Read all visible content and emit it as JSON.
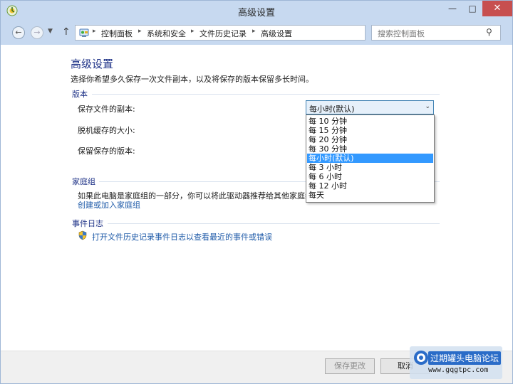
{
  "window": {
    "title": "高级设置",
    "minimize_glyph": "—",
    "maximize_glyph": "□",
    "close_glyph": "✕"
  },
  "nav": {
    "back_glyph": "←",
    "forward_glyph": "→",
    "recent_glyph": "▼",
    "up_glyph": "↑",
    "breadcrumbs": [
      "控制面板",
      "系统和安全",
      "文件历史记录",
      "高级设置"
    ],
    "separator_glyph": "▸",
    "address_dropdown_glyph": "▼",
    "refresh_glyph": "↻",
    "search_placeholder": "搜索控制面板",
    "search_glyph": "⚲"
  },
  "content": {
    "title": "高级设置",
    "description": "选择你希望多久保存一次文件副本，以及将保存的版本保留多长时间。",
    "versions": {
      "section_title": "版本",
      "save_copies_label": "保存文件的副本:",
      "offline_cache_label": "脱机缓存的大小:",
      "keep_versions_label": "保留保存的版本:",
      "frequency_value": "每小时(默认)",
      "frequency_arrow": "⌄",
      "frequency_options": [
        "每 10 分钟",
        "每 15 分钟",
        "每 20 分钟",
        "每 30 分钟",
        "每小时(默认)",
        "每 3 小时",
        "每 6 小时",
        "每 12 小时",
        "每天"
      ],
      "selected_index": 4
    },
    "homegroup": {
      "section_title": "家庭组",
      "text": "如果此电脑是家庭组的一部分，你可以将此驱动器推荐给其他家庭组成员",
      "link": "创建或加入家庭组"
    },
    "event_log": {
      "section_title": "事件日志",
      "link": "打开文件历史记录事件日志以查看最近的事件或错误"
    }
  },
  "footer": {
    "save_label": "保存更改",
    "cancel_label": "取消"
  },
  "watermark": {
    "name": "过期罐头电脑论坛",
    "url": "www.gqgtpc.com"
  },
  "colors": {
    "accent": "#1e3287",
    "link": "#1e5aa8",
    "selection": "#3399ff",
    "close_button": "#c74f4f"
  }
}
